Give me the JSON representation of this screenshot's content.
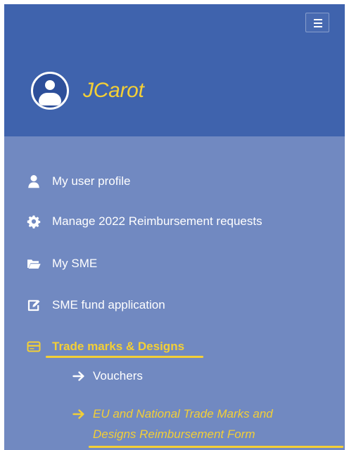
{
  "header": {
    "username": "JCarot"
  },
  "sidebar": {
    "items": [
      {
        "label": "My user profile"
      },
      {
        "label": "Manage 2022 Reimbursement requests"
      },
      {
        "label": "My SME"
      },
      {
        "label": "SME fund application"
      },
      {
        "label": "Trade marks & Designs"
      }
    ],
    "subitems": [
      {
        "label": "Vouchers"
      },
      {
        "label_line_1": "EU and National Trade Marks and",
        "label_line_2": "Designs Reimbursement Form"
      }
    ],
    "active_item_index": 4,
    "active_subitem_index": 1
  },
  "icons": {
    "menu_toggle": "hamburger-icon",
    "avatar": "user-avatar-icon",
    "items": [
      "user-icon",
      "gear-icon",
      "folder-open-icon",
      "edit-icon",
      "credit-card-icon"
    ],
    "subitems": [
      "arrow-right-icon",
      "arrow-right-icon"
    ]
  },
  "colors": {
    "header_background": "#3f63ad",
    "sidebar_background": "#7189c1",
    "accent": "#f3cf36",
    "text": "#ffffff"
  }
}
